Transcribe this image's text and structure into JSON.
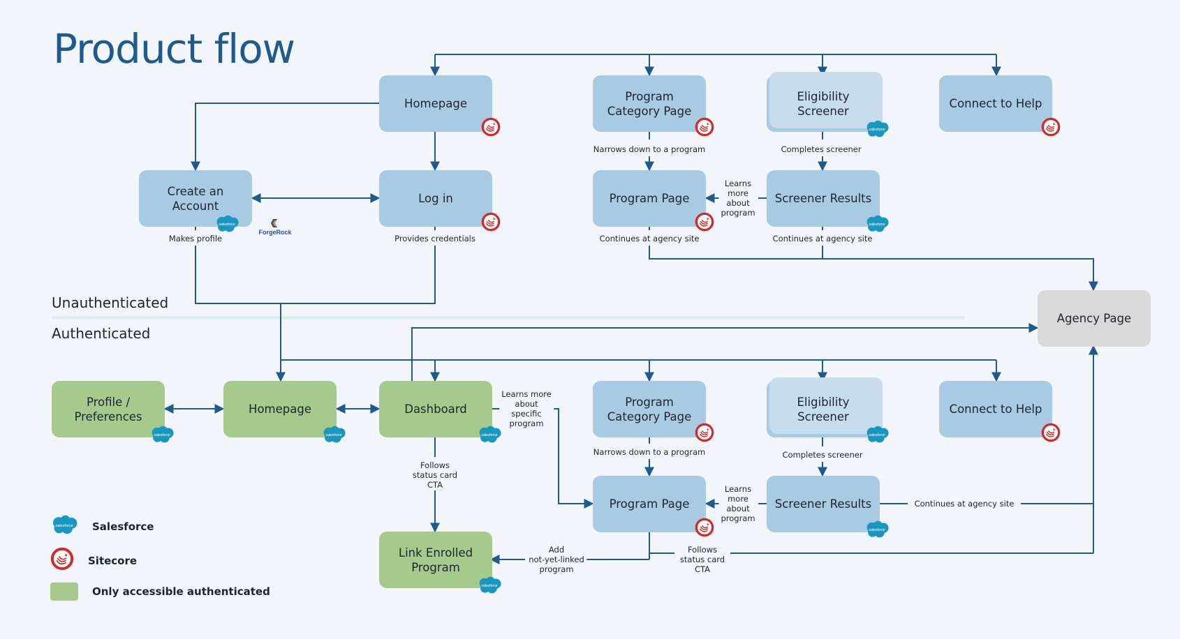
{
  "title": "Product flow",
  "sections": {
    "unauthenticated": "Unauthenticated",
    "authenticated": "Authenticated"
  },
  "colors": {
    "unauth_node": "#a9cae3",
    "auth_only_node": "#a6c98c",
    "external_node": "#d9d9d9",
    "connector": "#1f5a8f",
    "title": "#1f5a8f",
    "salesforce": "#1798c1",
    "sitecore": "#d12a2a"
  },
  "nodes": {
    "u_home": {
      "label": "Homepage",
      "badges": [
        "sitecore"
      ]
    },
    "u_progcat": {
      "label": "Program Category Page",
      "badges": [
        "sitecore"
      ]
    },
    "u_elig": {
      "label": "Eligibility Screener",
      "badges": [
        "salesforce"
      ]
    },
    "u_help": {
      "label": "Connect to Help",
      "badges": [
        "sitecore"
      ]
    },
    "u_create": {
      "label": "Create an Account",
      "badges": [
        "salesforce",
        "forgerock"
      ]
    },
    "u_login": {
      "label": "Log in",
      "badges": [
        "sitecore"
      ]
    },
    "u_prog": {
      "label": "Program Page",
      "badges": [
        "sitecore"
      ]
    },
    "u_results": {
      "label": "Screener Results",
      "badges": [
        "salesforce"
      ]
    },
    "agency": {
      "label": "Agency Page",
      "badges": []
    },
    "a_profile": {
      "label": "Profile / Preferences",
      "badges": [
        "salesforce"
      ]
    },
    "a_home": {
      "label": "Homepage",
      "badges": [
        "salesforce"
      ]
    },
    "a_dash": {
      "label": "Dashboard",
      "badges": [
        "salesforce"
      ]
    },
    "a_progcat": {
      "label": "Program Category Page",
      "badges": [
        "sitecore"
      ]
    },
    "a_elig": {
      "label": "Eligibility Screener",
      "badges": [
        "salesforce"
      ]
    },
    "a_help": {
      "label": "Connect to Help",
      "badges": [
        "sitecore"
      ]
    },
    "a_prog": {
      "label": "Program Page",
      "badges": [
        "sitecore"
      ]
    },
    "a_results": {
      "label": "Screener Results",
      "badges": [
        "salesforce"
      ]
    },
    "a_link": {
      "label": "Link Enrolled Program",
      "badges": [
        "salesforce"
      ]
    }
  },
  "edge_labels": {
    "makes_profile": "Makes profile",
    "provides_credentials": "Provides credentials",
    "u_narrows": "Narrows down to a program",
    "u_completes": "Completes screener",
    "u_learns": "Learns\nmore\nabout\nprogram",
    "u_prog_agency": "Continues at agency site",
    "u_results_agency": "Continues at agency site",
    "a_learns_specific": "Learns more\nabout\nspecific\nprogram",
    "a_follows_cta": "Follows\nstatus card\nCTA",
    "a_narrows": "Narrows down to a program",
    "a_completes": "Completes screener",
    "a_learns": "Learns\nmore\nabout\nprogram",
    "a_results_agency": "Continues at agency site",
    "a_add_link": "Add\nnot-yet-linked\nprogram",
    "a_prog_follows": "Follows\nstatus card\nCTA"
  },
  "badge_text": {
    "salesforce": "salesforce",
    "forgerock": "ForgeRock"
  },
  "legend": [
    {
      "icon": "salesforce",
      "label": "Salesforce"
    },
    {
      "icon": "sitecore",
      "label": "Sitecore"
    },
    {
      "icon": "green-swatch",
      "label": "Only accessible authenticated"
    }
  ]
}
